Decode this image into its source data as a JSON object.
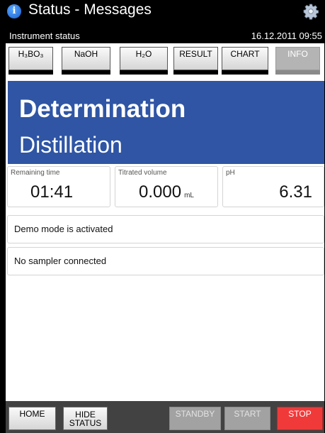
{
  "header": {
    "title": "Status - Messages",
    "subtitle": "Instrument status",
    "datetime": "16.12.2011 09:55",
    "info_icon_glyph": "i"
  },
  "tabs": [
    {
      "label": "H₃BO₃",
      "enabled": true
    },
    {
      "label": "NaOH",
      "enabled": true
    },
    {
      "label": "H₂O",
      "enabled": true
    },
    {
      "label": "RESULT",
      "enabled": true
    },
    {
      "label": "CHART",
      "enabled": true
    },
    {
      "label": "INFO",
      "enabled": false
    }
  ],
  "banner": {
    "line1": "Determination",
    "line2": "Distillation",
    "color": "#2f55a4"
  },
  "metrics": {
    "remaining_time": {
      "label": "Remaining time",
      "value": "01:41"
    },
    "titrated_volume": {
      "label": "Titrated volume",
      "value": "0.000",
      "unit": "mL"
    },
    "ph": {
      "label": "pH",
      "value": "6.31"
    }
  },
  "messages": [
    "Demo mode is activated",
    "No sampler connected"
  ],
  "footer": {
    "home": "HOME",
    "hide_status_line1": "HIDE",
    "hide_status_line2": "STATUS",
    "standby": "STANDBY",
    "start": "START",
    "stop": "STOP",
    "stop_color": "#f03a3a"
  }
}
